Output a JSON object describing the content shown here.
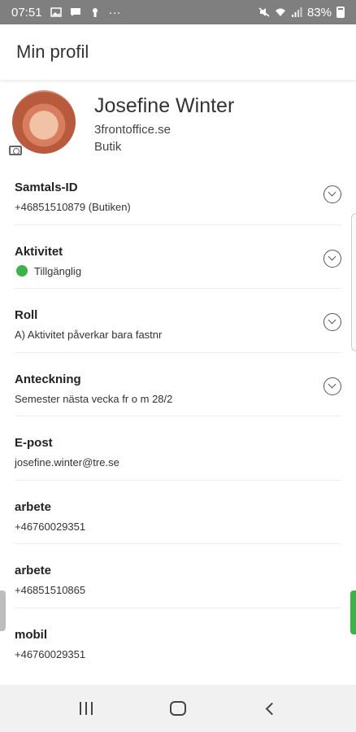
{
  "status_bar": {
    "time": "07:51",
    "left_icons": [
      "image-icon",
      "message-icon",
      "keyhole-icon",
      "more-icon"
    ],
    "dots": "···",
    "battery": "83%"
  },
  "header": {
    "title": "Min profil"
  },
  "profile": {
    "name": "Josefine Winter",
    "org": "3frontoffice.se",
    "dept": "Butik"
  },
  "rows": [
    {
      "title": "Samtals-ID",
      "value": "+46851510879 (Butiken)",
      "expandable": true
    },
    {
      "title": "Aktivitet",
      "value": "Tillgänglig",
      "expandable": true,
      "status_color": "#3bb34a"
    },
    {
      "title": "Roll",
      "value": "A) Aktivitet påverkar bara fastnr",
      "expandable": true
    },
    {
      "title": "Anteckning",
      "value": "Semester nästa vecka fr o m 28/2",
      "expandable": true
    },
    {
      "title": "E-post",
      "value": "josefine.winter@tre.se",
      "expandable": false
    },
    {
      "title": "arbete",
      "value": "+46760029351",
      "expandable": false
    },
    {
      "title": "arbete",
      "value": "+46851510865",
      "expandable": false
    },
    {
      "title": "mobil",
      "value": "+46760029351",
      "expandable": false
    }
  ],
  "colors": {
    "status_bar": "#7f7f7f",
    "accent_green": "#3bb34a"
  }
}
